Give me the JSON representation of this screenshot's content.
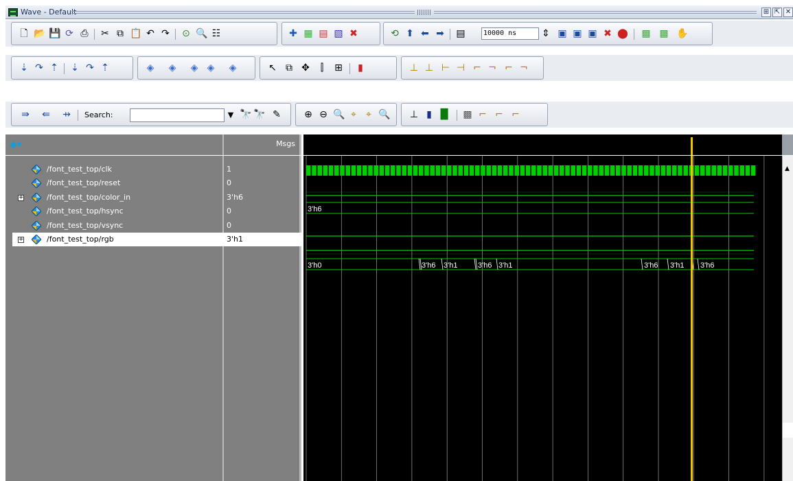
{
  "window": {
    "title": "Wave - Default",
    "buttons": [
      "⊞",
      "⇱",
      "✕"
    ]
  },
  "toolbar": {
    "time_value": "10000 ns",
    "search_label": "Search:",
    "search_value": "",
    "search_placeholder": ""
  },
  "wave_pane": {
    "msgs_header": "Msgs",
    "cursor_color": "#f3c400",
    "signal_color": "#00d000"
  },
  "signals": [
    {
      "name": "/font_test_top/clk",
      "value": "1",
      "expandable": false
    },
    {
      "name": "/font_test_top/reset",
      "value": "0",
      "expandable": false
    },
    {
      "name": "/font_test_top/color_in",
      "value": "3'h6",
      "expandable": true
    },
    {
      "name": "/font_test_top/hsync",
      "value": "0",
      "expandable": false
    },
    {
      "name": "/font_test_top/vsync",
      "value": "0",
      "expandable": false
    },
    {
      "name": "/font_test_top/rgb",
      "value": "3'h1",
      "expandable": true,
      "selected": true
    }
  ],
  "wave_labels": {
    "color_in": [
      "3'h6"
    ],
    "rgb": [
      "3'h0",
      "3'h6",
      "3'h1",
      "3'h6",
      "3'h1",
      "3'h6",
      "3'h1",
      "3'h6"
    ]
  }
}
